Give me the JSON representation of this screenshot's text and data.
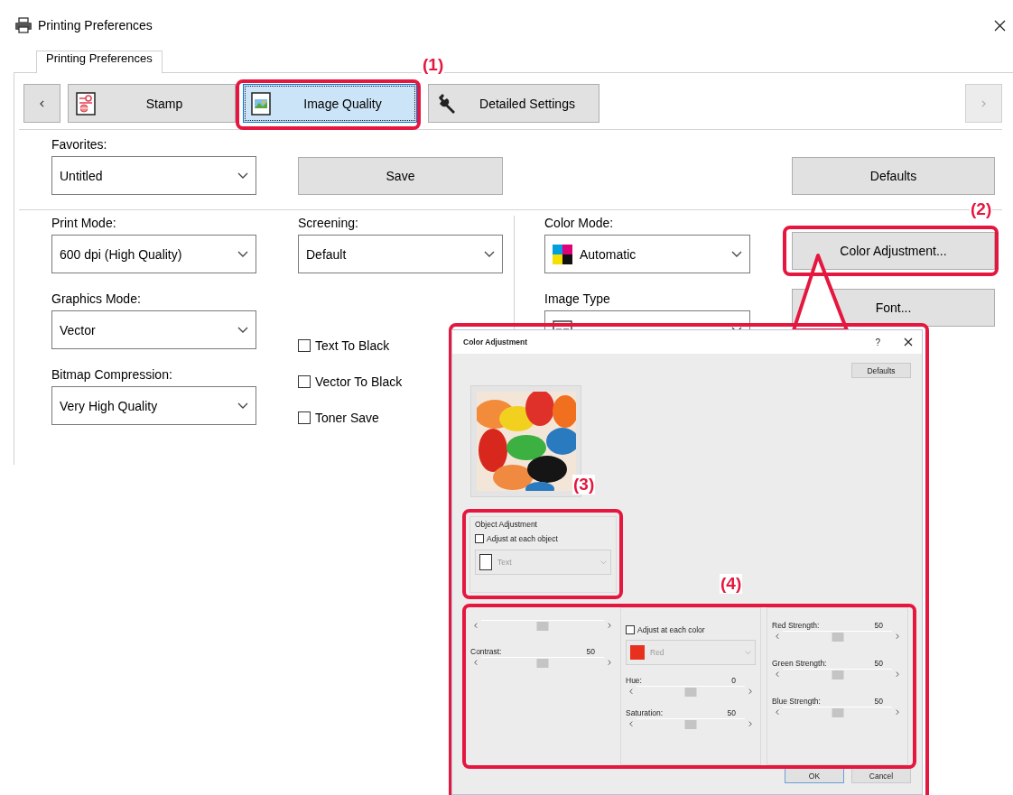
{
  "window": {
    "title": "Printing Preferences"
  },
  "tabs": [
    {
      "label": "Printing Preferences",
      "selected": true
    }
  ],
  "nav": {
    "next_disabled": true,
    "items": [
      {
        "kind": "stamp",
        "label": "Stamp",
        "selected": false
      },
      {
        "kind": "image",
        "label": "Image Quality",
        "selected": true
      },
      {
        "kind": "wrench",
        "label": "Detailed Settings",
        "selected": false
      }
    ]
  },
  "favorites": {
    "label": "Favorites:",
    "value": "Untitled"
  },
  "save_button": "Save",
  "defaults_button": "Defaults",
  "columns": [
    {
      "items": [
        {
          "kind": "dropdown",
          "label": "Print Mode:",
          "value": "600 dpi (High Quality)"
        },
        {
          "kind": "dropdown",
          "label": "Graphics Mode:",
          "value": "Vector"
        },
        {
          "kind": "dropdown",
          "label": "Bitmap Compression:",
          "value": "Very High Quality"
        }
      ]
    },
    {
      "items": [
        {
          "kind": "dropdown",
          "label": "Screening:",
          "value": "Default"
        },
        {
          "kind": "checkbox",
          "label": "Text To Black",
          "checked": false
        },
        {
          "kind": "checkbox",
          "label": "Vector To Black",
          "checked": false
        },
        {
          "kind": "checkbox",
          "label": "Toner Save",
          "checked": false
        }
      ]
    },
    {
      "items": [
        {
          "kind": "icon_dropdown",
          "label": "Color Mode:",
          "value": "Automatic"
        },
        {
          "kind": "icon_dropdown",
          "label": "Image Type"
        }
      ]
    },
    {
      "items": [
        {
          "kind": "button",
          "label": "Color Adjustment..."
        },
        {
          "kind": "button",
          "label": "Font..."
        }
      ]
    }
  ],
  "dialog": {
    "title": "Color Adjustment",
    "help_button": "?",
    "defaults_button": "Defaults",
    "object_adjustment": {
      "title": "Object Adjustment",
      "checkbox": {
        "label": "Adjust at each object",
        "checked": false
      },
      "dropdown": {
        "value": "Text",
        "disabled": true
      }
    },
    "left_sliders": [
      {
        "level": 0.5
      },
      {
        "label": "Contrast:",
        "value": "50",
        "level": 0.5
      }
    ],
    "color_adjustment": {
      "checkbox": {
        "label": "Adjust at each color",
        "checked": false
      },
      "dropdown": {
        "value": "Red",
        "disabled": true
      },
      "sliders": [
        {
          "label": "Hue:",
          "value": "0",
          "level": 0.5
        },
        {
          "label": "Saturation:",
          "value": "50",
          "level": 0.5
        }
      ]
    },
    "color_balance": {
      "sliders": [
        {
          "label": "Red Strength:",
          "value": "50",
          "level": 0.5
        },
        {
          "label": "Green Strength:",
          "value": "50",
          "level": 0.5
        },
        {
          "label": "Blue Strength:",
          "value": "50",
          "level": 0.5
        }
      ]
    },
    "buttons": [
      {
        "label": "OK",
        "default": true
      },
      {
        "label": "Cancel",
        "default": false
      }
    ]
  },
  "callouts": [
    {
      "label": "(1)"
    },
    {
      "label": "(2)"
    },
    {
      "label": "(3)"
    },
    {
      "label": "(4)"
    }
  ]
}
